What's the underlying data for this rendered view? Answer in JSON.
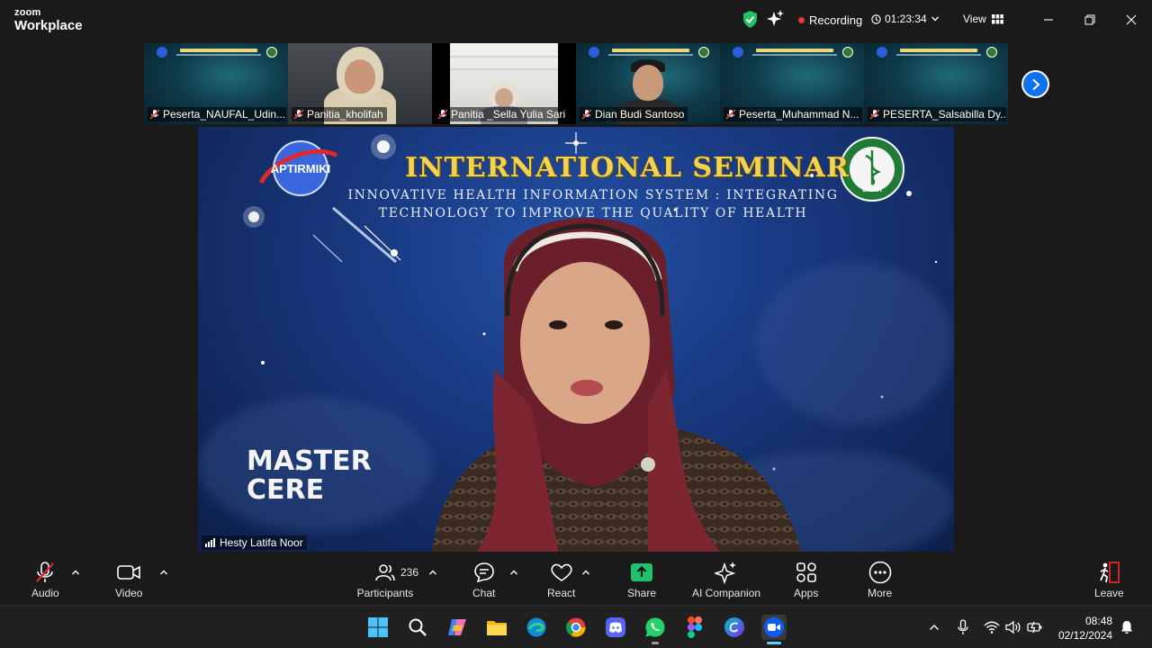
{
  "app": {
    "brand_line1": "zoom",
    "brand_line2": "Workplace"
  },
  "titlebar": {
    "recording_label": "Recording",
    "timer": "01:23:34",
    "view_label": "View"
  },
  "thumbnails": [
    {
      "name": "Peserta_NAUFAL_Udin...",
      "muted": true,
      "kind": "banner"
    },
    {
      "name": "Panitia_kholifah",
      "muted": true,
      "kind": "person-hijab-cream"
    },
    {
      "name": "Panitia _Sella Yulia Sari",
      "muted": true,
      "kind": "person-plain"
    },
    {
      "name": "Dian Budi Santoso",
      "muted": true,
      "kind": "person-male"
    },
    {
      "name": "Peserta_Muhammad N...",
      "muted": true,
      "kind": "banner"
    },
    {
      "name": "PESERTA_Salsabilla Dy...",
      "muted": true,
      "kind": "banner"
    }
  ],
  "main_video": {
    "seminar_title": "INTERNATIONAL SEMINAR",
    "seminar_subtitle_line1": "INNOVATIVE HEALTH INFORMATION SYSTEM : INTEGRATING",
    "seminar_subtitle_line2": "TECHNOLOGY TO IMPROVE THE QUALITY OF HEALTH SERVICES",
    "logo_left_text": "APTIRMIKI",
    "logo_right_text": "UNAIR",
    "background_text_line1": "MASTER",
    "background_text_line2": "CERE",
    "speaker_name": "Hesty Latifa Noor"
  },
  "toolbar": {
    "audio_label": "Audio",
    "video_label": "Video",
    "participants_label": "Participants",
    "participants_count": "236",
    "chat_label": "Chat",
    "react_label": "React",
    "share_label": "Share",
    "ai_label": "AI Companion",
    "apps_label": "Apps",
    "more_label": "More",
    "leave_label": "Leave"
  },
  "taskbar": {
    "time": "08:48",
    "date": "02/12/2024",
    "apps": [
      "start",
      "search",
      "copilot",
      "file-explorer",
      "edge",
      "chrome",
      "discord",
      "whatsapp",
      "figma",
      "canva",
      "zoom"
    ]
  },
  "colors": {
    "zoom_blue": "#0e72ed",
    "share_green": "#1fc16b",
    "recording_red": "#e5383b",
    "leave_red": "#e02828",
    "title_gold": "#f2d24f"
  }
}
